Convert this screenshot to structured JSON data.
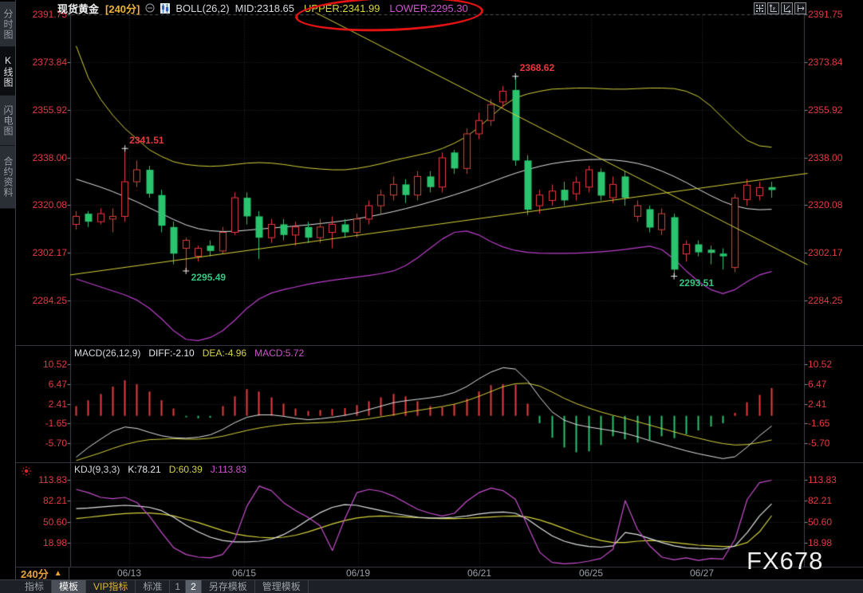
{
  "header": {
    "symbol": "现货黄金",
    "period": "[240分]",
    "boll": "BOLL(26,2)",
    "mid": "MID:2318.65",
    "upper": "UPPER:2341.99",
    "lower": "LOWER:2295.30"
  },
  "sidebar": {
    "items": [
      {
        "label": "分时图",
        "selected": false
      },
      {
        "label": "K线图",
        "selected": true
      },
      {
        "label": "闪电图",
        "selected": false
      },
      {
        "label": "合约资料",
        "selected": false
      }
    ]
  },
  "toolbar": {
    "icons": [
      "crosshair-icon",
      "axis-scale-left-icon",
      "axis-scale-fit-icon",
      "axis-shift-right-icon"
    ]
  },
  "panes": {
    "macd": {
      "name": "MACD(26,12,9)",
      "diff": "DIFF:-2.10",
      "dea": "DEA:-4.96",
      "macd": "MACD:5.72"
    },
    "kdj": {
      "name": "KDJ(9,3,3)",
      "k": "K:78.21",
      "d": "D:60.39",
      "j": "J:113.83"
    }
  },
  "bottom": {
    "period": "240分",
    "collapse_icon": "▲",
    "dates": [
      "06/13",
      "06/15",
      "06/19",
      "06/21",
      "06/25",
      "06/27"
    ],
    "tabs": [
      {
        "label": "指标",
        "active": false
      },
      {
        "label": "模板",
        "active": true
      },
      {
        "label": "VIP指标",
        "active": false
      },
      {
        "label": "标准",
        "active": false
      },
      {
        "label": "1",
        "active": false
      },
      {
        "label": "2",
        "active": true
      },
      {
        "label": "另存模板",
        "active": false
      },
      {
        "label": "管理模板",
        "active": false
      }
    ]
  },
  "watermark": "FX678",
  "annotation_ellipse": {
    "note": "hand-drawn red ellipse circling UPPER and LOWER Bollinger values",
    "color": "#e01212"
  },
  "colors": {
    "up_candle": "#e73c40",
    "down_candle": "#2bc46e",
    "axis_text": "#e23b41",
    "boll_upper": "#d4d23c",
    "boll_mid": "#dfe3e6",
    "boll_lower": "#bb3ecc",
    "diff_line": "#dfe3e6",
    "dea_line": "#d4d23c",
    "macd_line": "#c94fd0",
    "k_line": "#dfe3e6",
    "d_line": "#d4d23c",
    "j_line": "#c94fd0",
    "highlight_yellow": "#e8b33c",
    "grid": "#2a2d31"
  },
  "chart_data": [
    {
      "type": "candlestick",
      "title": "现货黄金 [240分]",
      "overlay": "BOLL(26,2)",
      "boll_now": {
        "mid": 2318.65,
        "upper": 2341.99,
        "lower": 2295.3
      },
      "ytick_labels": [
        "2391.75",
        "2373.84",
        "2355.92",
        "2338.00",
        "2320.08",
        "2302.17",
        "2284.25"
      ],
      "x_dates": [
        "06/13",
        "06/15",
        "06/19",
        "06/21",
        "06/25",
        "06/27"
      ],
      "annotations": [
        {
          "i": 4,
          "price": 2341.51,
          "text": "2341.51",
          "side": "high",
          "color": "#e8383d"
        },
        {
          "i": 9,
          "price": 2295.49,
          "text": "2295.49",
          "side": "low",
          "color": "#33c882"
        },
        {
          "i": 36,
          "price": 2368.62,
          "text": "2368.62",
          "side": "high",
          "color": "#e8383d"
        },
        {
          "i": 49,
          "price": 2293.51,
          "text": "2293.51",
          "side": "low",
          "color": "#33c882"
        }
      ],
      "trendlines": [
        {
          "style": "descending",
          "from": [
            19.6,
            2392.6
          ],
          "to": [
            60,
            2297.7
          ]
        },
        {
          "style": "ascending",
          "from": [
            -0.5,
            2294.0
          ],
          "to": [
            60,
            2332.2
          ]
        }
      ],
      "candles": [
        [
          2313,
          2318,
          2311,
          2316
        ],
        [
          2317,
          2318,
          2312,
          2314
        ],
        [
          2314,
          2319,
          2313,
          2317
        ],
        [
          2315,
          2319,
          2310,
          2316
        ],
        [
          2316,
          2341.51,
          2314,
          2329
        ],
        [
          2329,
          2337,
          2327,
          2333.5
        ],
        [
          2333.5,
          2335,
          2323,
          2324.5
        ],
        [
          2324,
          2326,
          2310,
          2312.5
        ],
        [
          2312,
          2314,
          2298,
          2302
        ],
        [
          2304,
          2308,
          2295.49,
          2307
        ],
        [
          2301,
          2305,
          2299,
          2304
        ],
        [
          2305,
          2307,
          2301,
          2303
        ],
        [
          2303,
          2312,
          2302,
          2310
        ],
        [
          2310,
          2325,
          2309,
          2323
        ],
        [
          2323,
          2325,
          2313,
          2316
        ],
        [
          2316,
          2318,
          2300,
          2308
        ],
        [
          2308,
          2315,
          2306,
          2313
        ],
        [
          2313,
          2315,
          2307,
          2309
        ],
        [
          2309,
          2314,
          2305,
          2312
        ],
        [
          2312,
          2314,
          2306,
          2308
        ],
        [
          2308,
          2315,
          2306,
          2312
        ],
        [
          2310,
          2316,
          2304,
          2313
        ],
        [
          2313,
          2315,
          2308,
          2310
        ],
        [
          2310,
          2317,
          2308,
          2315
        ],
        [
          2315,
          2322,
          2313,
          2320
        ],
        [
          2320,
          2326,
          2317,
          2324
        ],
        [
          2324,
          2331,
          2322,
          2328
        ],
        [
          2328,
          2330,
          2321,
          2324
        ],
        [
          2324,
          2333,
          2322,
          2331
        ],
        [
          2331,
          2333,
          2325,
          2327
        ],
        [
          2327,
          2340,
          2325,
          2338
        ],
        [
          2340,
          2341,
          2332,
          2334
        ],
        [
          2334,
          2349,
          2332,
          2347
        ],
        [
          2347,
          2355,
          2345,
          2352
        ],
        [
          2352,
          2360,
          2350,
          2358
        ],
        [
          2359,
          2365,
          2357,
          2363
        ],
        [
          2363.5,
          2368.62,
          2335,
          2337
        ],
        [
          2337,
          2339,
          2316.5,
          2318.5
        ],
        [
          2320,
          2326,
          2317,
          2324
        ],
        [
          2322,
          2328,
          2320,
          2325.5
        ],
        [
          2326,
          2329,
          2320,
          2322
        ],
        [
          2324.5,
          2331,
          2322,
          2328.8
        ],
        [
          2327,
          2335,
          2325,
          2333.5
        ],
        [
          2332.7,
          2334,
          2322,
          2323.8
        ],
        [
          2323,
          2331,
          2321,
          2328
        ],
        [
          2331,
          2333,
          2320,
          2323
        ],
        [
          2316,
          2322,
          2314,
          2320
        ],
        [
          2318.7,
          2320,
          2310,
          2311.8
        ],
        [
          2311,
          2319,
          2309,
          2317
        ],
        [
          2315.7,
          2317,
          2293.51,
          2296
        ],
        [
          2301.9,
          2307,
          2299,
          2305.5
        ],
        [
          2305.5,
          2307,
          2301,
          2302.5
        ],
        [
          2303.5,
          2305,
          2298,
          2302.3
        ],
        [
          2302,
          2304,
          2296,
          2301
        ],
        [
          2296.8,
          2324.4,
          2295,
          2322.9
        ],
        [
          2322.3,
          2330,
          2320,
          2327.7
        ],
        [
          2323.8,
          2329,
          2322,
          2326.8
        ],
        [
          2327,
          2329,
          2323,
          2325.9
        ]
      ],
      "boll_upper": [
        2380,
        2368,
        2360,
        2354,
        2349,
        2345,
        2341,
        2338.5,
        2336.5,
        2335.5,
        2335,
        2334.8,
        2335,
        2335.5,
        2336,
        2336.2,
        2336,
        2335.5,
        2334.8,
        2334.2,
        2333.8,
        2333.5,
        2333.5,
        2334,
        2334.8,
        2335.8,
        2337,
        2338,
        2339,
        2340,
        2341.5,
        2343.5,
        2346,
        2349.5,
        2353.5,
        2357.5,
        2360.5,
        2362,
        2363,
        2363.8,
        2364,
        2364.2,
        2364.2,
        2364,
        2363.8,
        2363.8,
        2364,
        2364.2,
        2364.2,
        2364,
        2363,
        2361,
        2357.5,
        2353,
        2348.5,
        2344.5,
        2342.5,
        2341.99
      ],
      "boll_mid": [
        2330,
        2328.5,
        2327,
        2325.3,
        2323.4,
        2321.4,
        2319.2,
        2317,
        2314.8,
        2312.8,
        2311.4,
        2310.6,
        2310.3,
        2310.4,
        2310.8,
        2311.2,
        2311.6,
        2312,
        2312.4,
        2312.8,
        2313.3,
        2313.8,
        2314.4,
        2315.1,
        2315.9,
        2316.8,
        2317.8,
        2318.9,
        2320.1,
        2321.4,
        2322.7,
        2324.1,
        2325.6,
        2327.2,
        2328.9,
        2330.6,
        2332.2,
        2333.6,
        2334.8,
        2335.8,
        2336.5,
        2337,
        2337.3,
        2337.4,
        2337.2,
        2336.7,
        2335.9,
        2334.7,
        2333,
        2331,
        2328.7,
        2326.2,
        2323.8,
        2321.6,
        2319.9,
        2318.9,
        2318.5,
        2318.65
      ],
      "boll_lower": [
        2292.5,
        2291,
        2289.5,
        2288,
        2286.5,
        2284.5,
        2281.5,
        2277.5,
        2273,
        2269.8,
        2269.3,
        2270.5,
        2273,
        2277,
        2281.5,
        2285,
        2287.2,
        2288.5,
        2289.5,
        2290.5,
        2291.3,
        2292,
        2292.6,
        2293.2,
        2293.8,
        2294.5,
        2295.5,
        2297.5,
        2300.5,
        2304,
        2307.5,
        2310,
        2310.5,
        2309,
        2306.5,
        2304.5,
        2303.2,
        2302.5,
        2302.2,
        2302.1,
        2302.1,
        2302.2,
        2302.4,
        2302.7,
        2303.1,
        2303.6,
        2304.2,
        2304.8,
        2303.5,
        2300,
        2295.5,
        2291.5,
        2288.5,
        2287,
        2288.5,
        2291.5,
        2294,
        2295.3
      ]
    },
    {
      "type": "macd",
      "params": "MACD(26,12,9)",
      "now": {
        "diff": -2.1,
        "dea": -4.96,
        "macd": 5.72
      },
      "ytick_labels": [
        "10.52",
        "6.47",
        "2.41",
        "-1.65",
        "-5.70"
      ],
      "hist": [
        2.0,
        3.2,
        4.5,
        6.0,
        7.3,
        6.5,
        5.0,
        3.2,
        1.5,
        -0.3,
        -0.5,
        -0.4,
        2.0,
        4.0,
        5.5,
        5.0,
        3.8,
        2.5,
        1.5,
        1.0,
        1.2,
        1.4,
        1.6,
        2.2,
        3.0,
        3.8,
        4.5,
        4.0,
        3.0,
        2.0,
        1.8,
        2.4,
        3.5,
        5.0,
        6.3,
        6.5,
        6.4,
        2.5,
        -1.5,
        -4.5,
        -6.5,
        -7.5,
        -7.3,
        -6.0,
        -4.2,
        -4.8,
        -5.5,
        -5.0,
        -4.2,
        -4.6,
        -3.8,
        -3.0,
        -2.2,
        -1.5,
        0.6,
        2.8,
        4.3,
        5.72
      ],
      "diff": [
        -8.5,
        -6.5,
        -4.8,
        -3.2,
        -2.3,
        -2.6,
        -3.4,
        -4.1,
        -4.5,
        -4.6,
        -4.4,
        -3.9,
        -2.8,
        -1.4,
        -0.3,
        0.2,
        0.2,
        -0.1,
        -0.5,
        -0.8,
        -0.6,
        -0.3,
        0.1,
        0.6,
        1.3,
        2.0,
        2.7,
        3.1,
        3.4,
        3.7,
        4.1,
        4.8,
        6.0,
        7.6,
        9.0,
        9.9,
        9.6,
        7.2,
        3.8,
        0.8,
        -0.9,
        -1.8,
        -2.3,
        -2.7,
        -3.1,
        -3.6,
        -4.3,
        -5.1,
        -5.8,
        -6.5,
        -7.2,
        -7.8,
        -8.3,
        -8.8,
        -8.4,
        -6.4,
        -4.1,
        -2.1
      ],
      "dea": [
        -9.2,
        -8.4,
        -7.6,
        -6.7,
        -5.9,
        -5.3,
        -4.9,
        -4.8,
        -4.7,
        -4.8,
        -4.8,
        -4.6,
        -4.2,
        -3.6,
        -3.0,
        -2.5,
        -2.1,
        -1.8,
        -1.6,
        -1.5,
        -1.4,
        -1.3,
        -1.1,
        -0.9,
        -0.6,
        -0.2,
        0.2,
        0.7,
        1.1,
        1.5,
        1.9,
        2.4,
        3.1,
        4.0,
        5.0,
        6.0,
        6.6,
        6.7,
        6.1,
        4.9,
        3.6,
        2.5,
        1.6,
        0.8,
        0.1,
        -0.5,
        -1.2,
        -1.9,
        -2.6,
        -3.3,
        -4.0,
        -4.6,
        -5.2,
        -5.7,
        -6.0,
        -5.9,
        -5.5,
        -4.96
      ]
    },
    {
      "type": "kdj",
      "params": "KDJ(9,3,3)",
      "now": {
        "k": 78.21,
        "d": 60.39,
        "j": 113.83
      },
      "ytick_labels": [
        "113.83",
        "82.21",
        "50.60",
        "18.98"
      ],
      "k": [
        71,
        72,
        73.5,
        75,
        76,
        75,
        73,
        68,
        58,
        46,
        36,
        28,
        23,
        21,
        21,
        22,
        25,
        32,
        42,
        54,
        65,
        73,
        77,
        76,
        72,
        68,
        64,
        61,
        58,
        57,
        57,
        58,
        60,
        63,
        65,
        66,
        64,
        55,
        42,
        30,
        22,
        17,
        14,
        13,
        15,
        35,
        32,
        26,
        20,
        15,
        12,
        11,
        10.5,
        10,
        15,
        35,
        60,
        78.21
      ],
      "d": [
        56,
        58,
        60,
        62,
        63.5,
        64.5,
        64.5,
        63,
        60,
        55,
        50,
        44,
        38,
        33,
        30,
        28,
        27,
        28,
        31,
        36,
        42,
        48,
        53,
        57,
        59,
        60,
        59.5,
        58.5,
        57.5,
        56.5,
        56,
        56,
        56.5,
        57.5,
        58.5,
        59.5,
        60,
        58.5,
        54,
        48,
        41,
        34,
        28,
        23,
        20,
        20,
        22,
        23,
        22,
        20,
        18,
        16,
        15,
        14,
        14.5,
        20,
        36,
        60.39
      ],
      "j": [
        100,
        95,
        88,
        86,
        88,
        80,
        60,
        35,
        12,
        2,
        -2,
        -3,
        2,
        25,
        75,
        105,
        98,
        80,
        68,
        58,
        45,
        8,
        55,
        95,
        100,
        97,
        90,
        80,
        70,
        64,
        60,
        64,
        82,
        95,
        102,
        98,
        85,
        45,
        5,
        -10,
        -12,
        -11,
        -8,
        -4,
        10,
        83,
        40,
        15,
        -2,
        -6,
        -3,
        -7,
        -4,
        -5,
        25,
        85,
        110,
        113.83
      ]
    }
  ]
}
